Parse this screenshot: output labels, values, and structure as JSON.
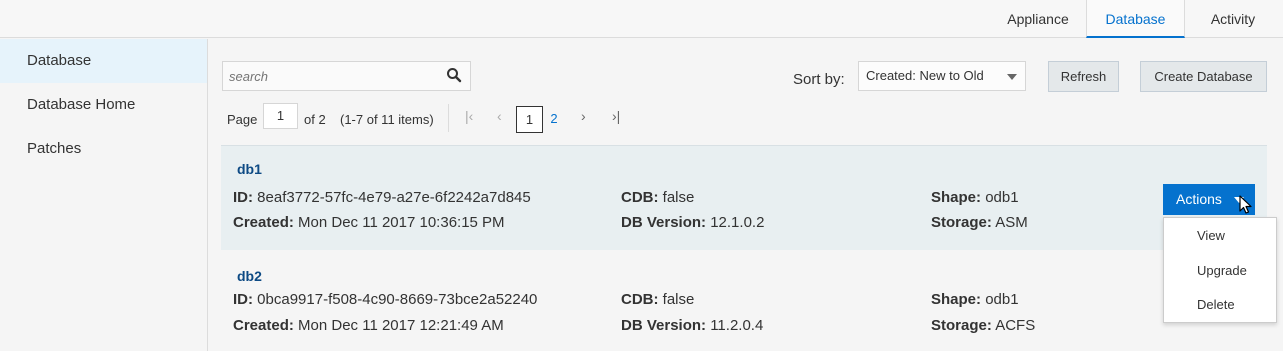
{
  "top_tabs": [
    {
      "label": "Appliance",
      "active": false
    },
    {
      "label": "Database",
      "active": true
    },
    {
      "label": "Activity",
      "active": false
    }
  ],
  "sidebar": {
    "items": [
      {
        "label": "Database",
        "active": true
      },
      {
        "label": "Database Home",
        "active": false
      },
      {
        "label": "Patches",
        "active": false
      }
    ]
  },
  "toolbar": {
    "search_placeholder": "search",
    "sort_label": "Sort by:",
    "sort_value": "Created: New to Old",
    "refresh_label": "Refresh",
    "create_label": "Create Database"
  },
  "pagination": {
    "page_label": "Page",
    "current_page": "1",
    "of_pages": "of 2",
    "items_range": "(1-7 of 11 items)",
    "pages": [
      "1",
      "2"
    ]
  },
  "databases": [
    {
      "name": "db1",
      "id_label": "ID:",
      "id": "8eaf3772-57fc-4e79-a27e-6f2242a7d845",
      "created_label": "Created:",
      "created": "Mon Dec 11 2017 10:36:15 PM",
      "cdb_label": "CDB:",
      "cdb": "false",
      "version_label": "DB Version:",
      "version": "12.1.0.2",
      "shape_label": "Shape:",
      "shape": "odb1",
      "storage_label": "Storage:",
      "storage": "ASM"
    },
    {
      "name": "db2",
      "id_label": "ID:",
      "id": "0bca9917-f508-4c90-8669-73bce2a52240",
      "created_label": "Created:",
      "created": "Mon Dec 11 2017 12:21:49 AM",
      "cdb_label": "CDB:",
      "cdb": "false",
      "version_label": "DB Version:",
      "version": "11.2.0.4",
      "shape_label": "Shape:",
      "shape": "odb1",
      "storage_label": "Storage:",
      "storage": "ACFS"
    }
  ],
  "actions": {
    "label": "Actions",
    "menu": [
      "View",
      "Upgrade",
      "Delete"
    ]
  },
  "colors": {
    "accent": "#0572ce",
    "selected_row": "#e8eff1",
    "sidebar_active": "#e6f3fb"
  }
}
